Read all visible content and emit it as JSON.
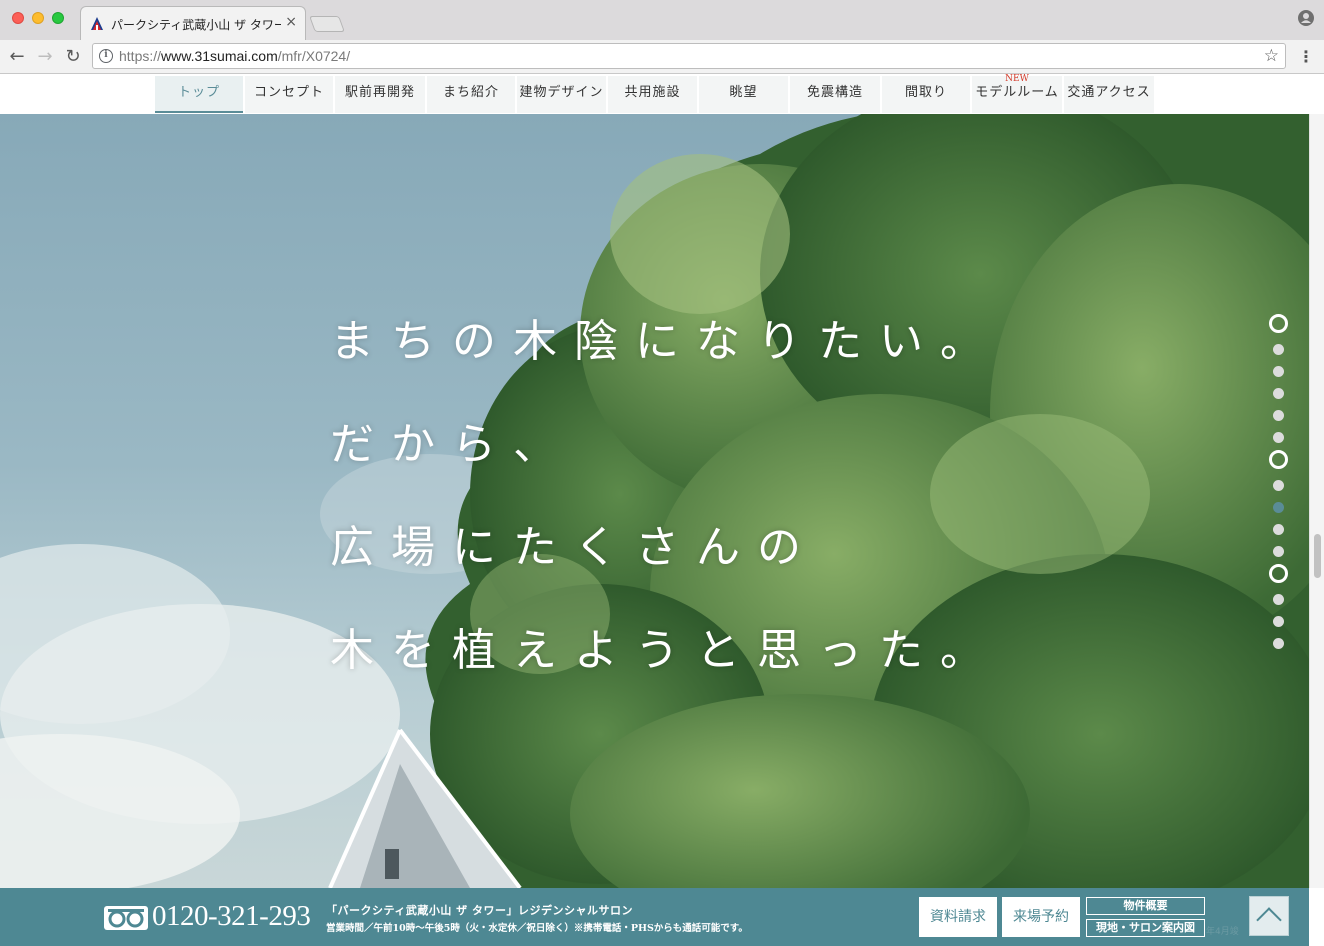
{
  "browser": {
    "tab_title": "パークシティ武蔵小山 ザ タワー",
    "tab_close": "×",
    "url_prefix": "https://",
    "url_host": "www.31sumai.com",
    "url_path": "/mfr/X0724/",
    "icons": [
      "close-icon",
      "back-icon",
      "forward-icon",
      "reload-icon",
      "info-icon",
      "star-icon",
      "menu-icon",
      "profile-icon"
    ]
  },
  "nav": {
    "items": [
      {
        "label": "トップ"
      },
      {
        "label": "コンセプト"
      },
      {
        "label": "駅前再開発"
      },
      {
        "label": "まち紹介"
      },
      {
        "label": "建物デザイン"
      },
      {
        "label": "共用施設"
      },
      {
        "label": "眺望"
      },
      {
        "label": "免震構造"
      },
      {
        "label": "間取り"
      },
      {
        "label": "モデルルーム",
        "badge": "NEW"
      },
      {
        "label": "交通アクセス"
      }
    ],
    "active_index": 0
  },
  "hero": {
    "lines": [
      "まちの木陰になりたい。",
      "だから、",
      "広場にたくさんの",
      "木を植えようと思った。"
    ]
  },
  "slide_dots": {
    "count": 15,
    "ring_indices": [
      0,
      6,
      11
    ],
    "current_index": 8
  },
  "footer": {
    "tel": "0120-321-293",
    "salon": "「パークシティ武蔵小山 ザ タワー」レジデンシャルサロン",
    "hours": "営業時間／午前10時～午後5時（火・水定休／祝日除く）※携帯電話・PHSからも通話可能です。",
    "btn_siryo": "資料請求",
    "btn_raijo": "来場予約",
    "btn_gaiyou": "物件概要",
    "btn_map": "現地・サロン案内図",
    "ghost": "年4月竣"
  },
  "colors": {
    "accent": "#4e8893",
    "new_badge": "#d43a2a"
  }
}
